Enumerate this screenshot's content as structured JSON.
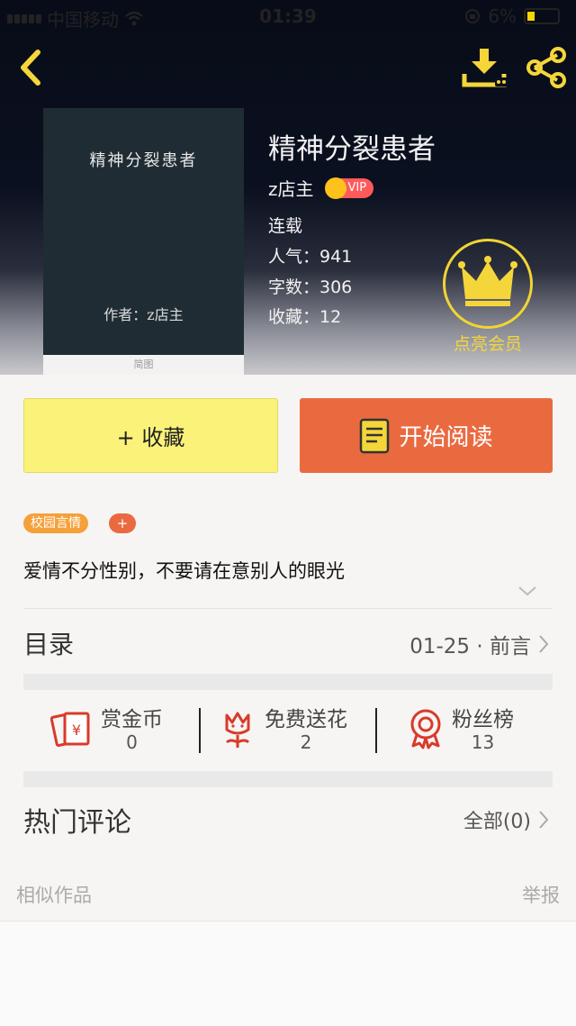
{
  "status_bar": {
    "carrier": "中国移动",
    "time": "01:39",
    "battery": "6%"
  },
  "book": {
    "title": "精神分裂患者",
    "author": "z店主",
    "vip_badge": "VIP",
    "status": "连载",
    "popularity": "人气：941",
    "word_count": "字数：306",
    "favorites": "收藏：12",
    "cover_title": "精神分裂患者",
    "cover_author": "作者：z店主",
    "cover_caption": "简图"
  },
  "member": {
    "label": "点亮会员",
    "accent": "#f5d63a"
  },
  "actions": {
    "collect_label": "+ 收藏",
    "read_label": "开始阅读",
    "collect_color": "#fbf27a",
    "read_color": "#ea6a40"
  },
  "tags": {
    "genre": "校园言情",
    "add": "+"
  },
  "description": "爱情不分性别，不要请在意别人的眼光",
  "toc": {
    "label": "目录",
    "latest": "01-25 · 前言"
  },
  "stats": [
    {
      "label": "赏金币",
      "value": "0",
      "icon": "red-envelope-icon"
    },
    {
      "label": "免费送花",
      "value": "2",
      "icon": "flower-icon"
    },
    {
      "label": "粉丝榜",
      "value": "13",
      "icon": "medal-icon"
    }
  ],
  "comments": {
    "label": "热门评论",
    "all": "全部(0)"
  },
  "footer": {
    "similar": "相似作品",
    "report": "举报"
  }
}
